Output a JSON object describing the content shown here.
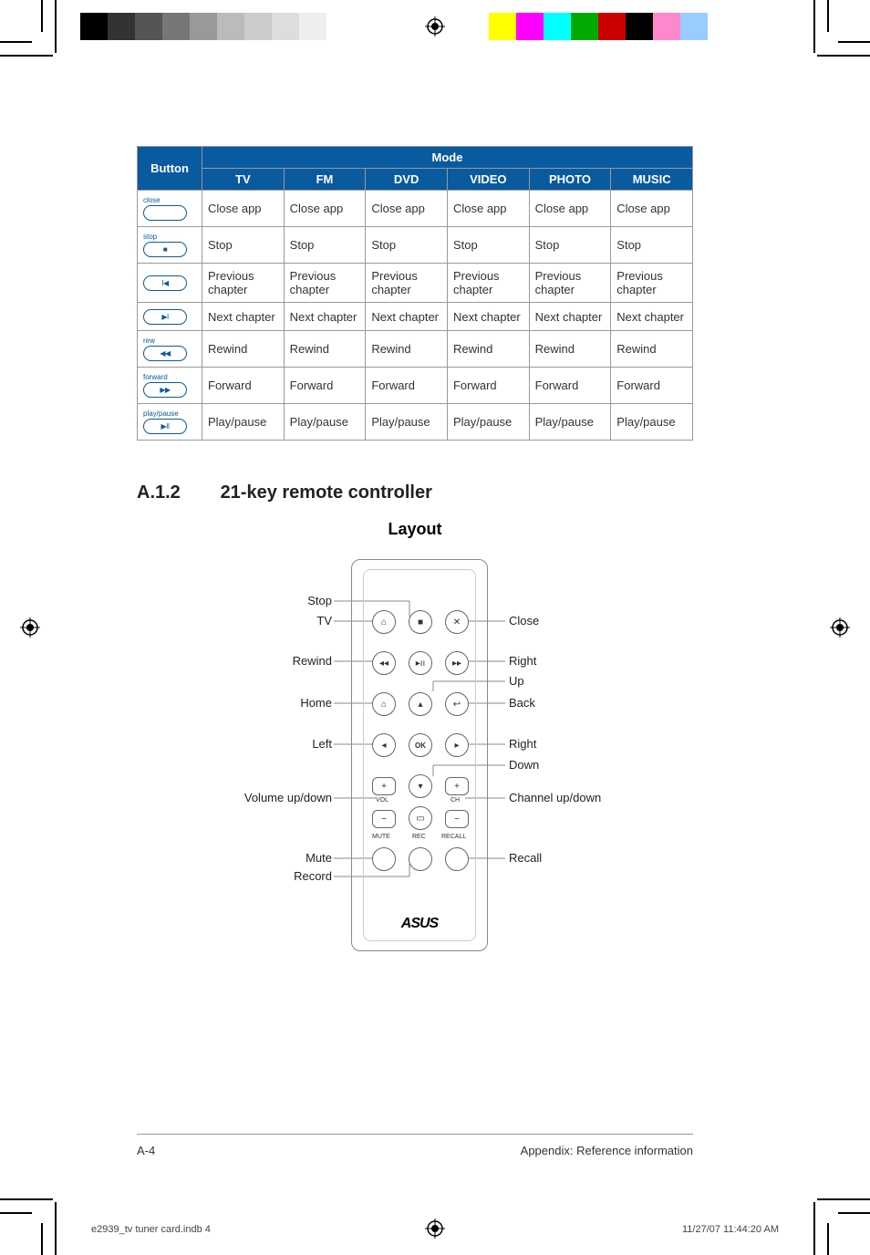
{
  "table": {
    "header_button": "Button",
    "header_mode": "Mode",
    "modes": [
      "TV",
      "FM",
      "DVD",
      "VIDEO",
      "PHOTO",
      "MUSIC"
    ],
    "rows": [
      {
        "label": "close",
        "symbol": "",
        "cells": [
          "Close app",
          "Close app",
          "Close app",
          "Close app",
          "Close app",
          "Close app"
        ]
      },
      {
        "label": "stop",
        "symbol": "■",
        "cells": [
          "Stop",
          "Stop",
          "Stop",
          "Stop",
          "Stop",
          "Stop"
        ]
      },
      {
        "label": "",
        "symbol": "I◀",
        "cells": [
          "Previous chapter",
          "Previous chapter",
          "Previous chapter",
          "Previous chapter",
          "Previous chapter",
          "Previous chapter"
        ]
      },
      {
        "label": "",
        "symbol": "▶I",
        "cells": [
          "Next chapter",
          "Next chapter",
          "Next chapter",
          "Next chapter",
          "Next chapter",
          "Next chapter"
        ]
      },
      {
        "label": "rew",
        "symbol": "◀◀",
        "cells": [
          "Rewind",
          "Rewind",
          "Rewind",
          "Rewind",
          "Rewind",
          "Rewind"
        ]
      },
      {
        "label": "forward",
        "symbol": "▶▶",
        "cells": [
          "Forward",
          "Forward",
          "Forward",
          "Forward",
          "Forward",
          "Forward"
        ]
      },
      {
        "label": "play/pause",
        "symbol": "▶II",
        "cells": [
          "Play/pause",
          "Play/pause",
          "Play/pause",
          "Play/pause",
          "Play/pause",
          "Play/pause"
        ]
      }
    ]
  },
  "heading_num": "A.1.2",
  "heading_text": "21-key remote controller",
  "layout_title": "Layout",
  "remote": {
    "left_labels": [
      "Stop",
      "TV",
      "Rewind",
      "Home",
      "Left",
      "Volume up/down",
      "Mute",
      "Record"
    ],
    "right_labels": [
      "Close",
      "Right",
      "Up",
      "Back",
      "Right",
      "Down",
      "Channel up/down",
      "Recall"
    ],
    "vol_label": "VOL",
    "ch_label": "CH",
    "mute_label": "MUTE",
    "rec_label": "REC",
    "recall_label": "RECALL",
    "ok_label": "OK",
    "brand": "ASUS"
  },
  "footer_page": "A-4",
  "footer_text": "Appendix: Reference information",
  "slug_file": "e2939_tv tuner card.indb   4",
  "slug_time": "11/27/07   11:44:20 AM"
}
